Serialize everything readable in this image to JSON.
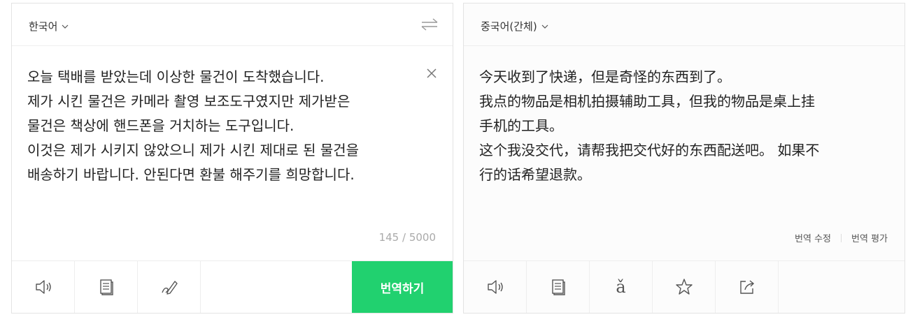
{
  "source": {
    "language": "한국어",
    "text": "오늘 택배를 받았는데 이상한 물건이 도착했습니다.\n제가 시킨 물건은 카메라 촬영 보조도구였지만 제가받은\n물건은 책상에 핸드폰을 거치하는 도구입니다.\n이것은 제가 시키지 않았으니 제가 시킨 제대로 된 물건을\n배송하기 바랍니다. 안된다면 환불 해주기를 희망합니다.",
    "counter": "145 / 5000",
    "translate_label": "번역하기",
    "tools": [
      "speaker-icon",
      "dictionary-icon",
      "handwriting-icon"
    ]
  },
  "target": {
    "language": "중국어(간체)",
    "text": "今天收到了快递，但是奇怪的东西到了。\n我点的物品是相机拍摄辅助工具，但我的物品是桌上挂\n手机的工具。\n这个我没交代，请帮我把交代好的东西配送吧。 如果不\n行的话希望退款。",
    "edit_label": "번역 수정",
    "rate_label": "번역 평가",
    "pinyin_glyph": "ǎ",
    "tools": [
      "speaker-icon",
      "dictionary-icon",
      "pinyin-icon",
      "star-icon",
      "share-icon"
    ]
  },
  "colors": {
    "accent": "#21d16f",
    "border": "#e3e3e3",
    "muted": "#aaaaaa"
  }
}
